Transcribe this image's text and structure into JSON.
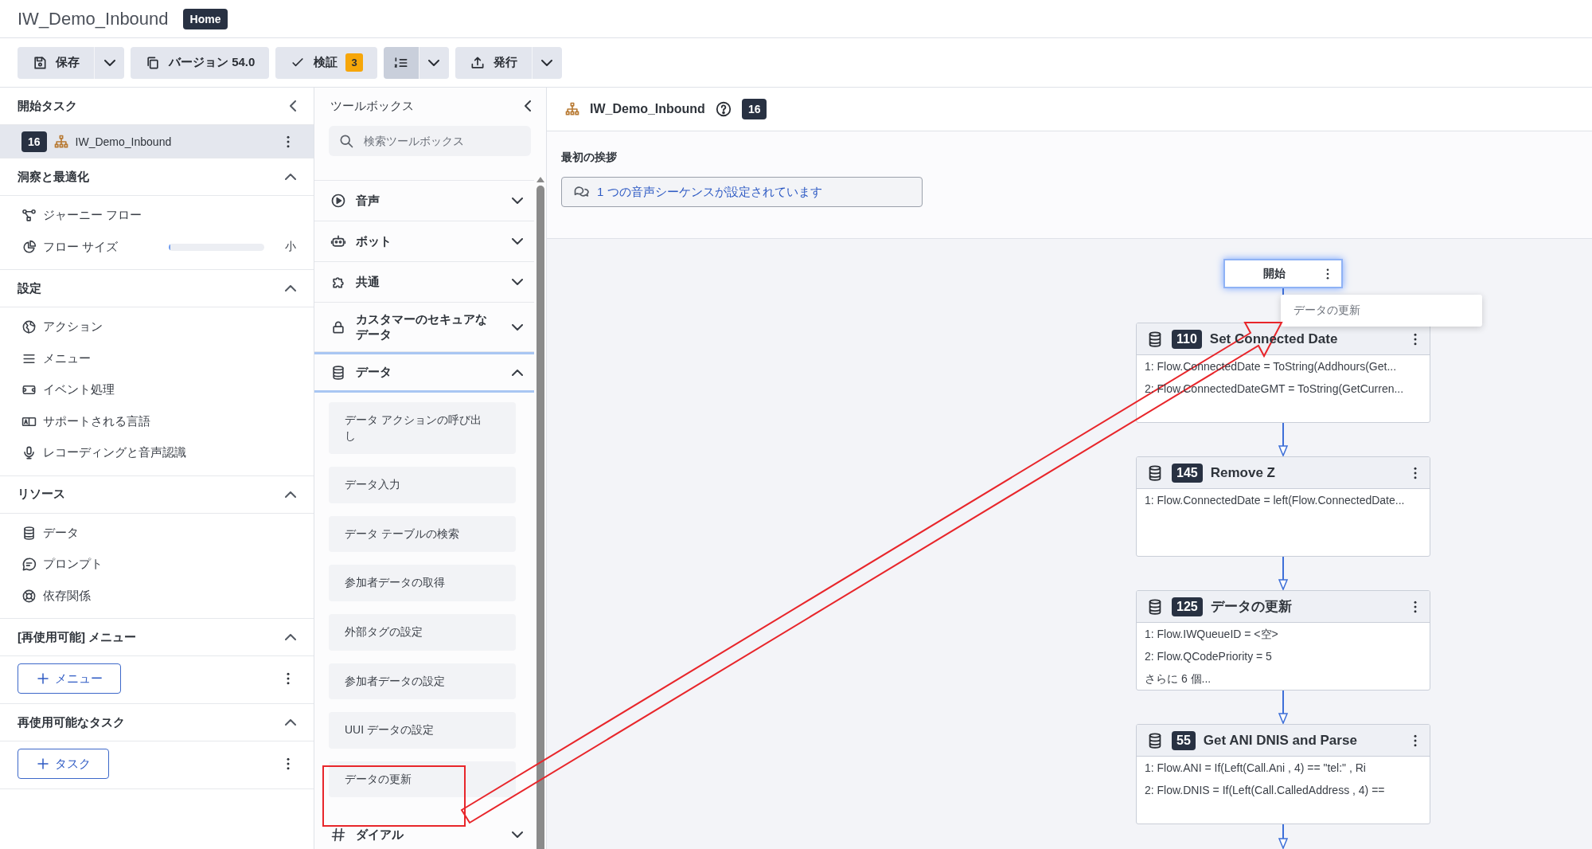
{
  "header": {
    "title": "IW_Demo_Inbound",
    "badge": "Home"
  },
  "toolbar": [
    {
      "label": "保存",
      "dropdown": true,
      "pressed": false
    },
    {
      "label": "バージョン 54.0",
      "dropdown": false,
      "pressed": false
    },
    {
      "label": "検証",
      "count": "3",
      "dropdown": false,
      "pressed": false
    },
    {
      "dropdown": true,
      "pressed": true
    },
    {
      "label": "発行",
      "dropdown": true,
      "pressed": false
    }
  ],
  "start_tasks": {
    "title": "開始タスク",
    "items": [
      {
        "badge": "16",
        "label": "IW_Demo_Inbound",
        "selected": true
      }
    ]
  },
  "sections": [
    {
      "title": "洞察と最適化",
      "expanded": true,
      "items": [
        {
          "kind": "link",
          "label": "ジャーニー フロー"
        },
        {
          "kind": "meter",
          "label": "フロー サイズ",
          "level": 0.02,
          "reading": "小"
        }
      ]
    },
    {
      "title": "設定",
      "expanded": true,
      "items": [
        {
          "kind": "link",
          "label": "アクション"
        },
        {
          "kind": "link",
          "label": "メニュー"
        },
        {
          "kind": "link",
          "label": "イベント処理"
        },
        {
          "kind": "link",
          "label": "サポートされる言語"
        },
        {
          "kind": "link",
          "label": "レコーディングと音声認識"
        }
      ]
    },
    {
      "title": "リソース",
      "expanded": true,
      "items": [
        {
          "kind": "link",
          "label": "データ"
        },
        {
          "kind": "link",
          "label": "プロンプト"
        },
        {
          "kind": "link",
          "label": "依存関係"
        }
      ]
    },
    {
      "title": "[再使用可能] メニュー",
      "expanded": true,
      "items": [
        {
          "kind": "add",
          "label": "メニュー"
        }
      ]
    },
    {
      "title": "再使用可能なタスク",
      "expanded": true,
      "items": [
        {
          "kind": "add",
          "label": "タスク"
        }
      ]
    }
  ],
  "toolbox": {
    "title": "ツールボックス",
    "search": {
      "placeholder": "検索ツールボックス"
    },
    "categories": [
      {
        "label": "音声",
        "expanded": false
      },
      {
        "label": "ボット",
        "expanded": false
      },
      {
        "label": "共通",
        "expanded": false
      },
      {
        "label": "カスタマーのセキュアなデータ",
        "expanded": false
      },
      {
        "label": "データ",
        "expanded": true,
        "items": [
          "データ アクションの呼び出し",
          "データ入力",
          "データ テーブルの検索",
          "参加者データの取得",
          "外部タグの設定",
          "参加者データの設定",
          "UUI データの設定",
          "データの更新"
        ]
      },
      {
        "label": "ダイアル",
        "expanded": false
      }
    ]
  },
  "flow_header": {
    "title": "IW_Demo_Inbound",
    "count": "16"
  },
  "greeting": {
    "label": "最初の挨拶",
    "value": "1 つの音声シーケンスが設定されています"
  },
  "canvas": {
    "start": {
      "label": "開始",
      "selected": true
    },
    "tooltip": "データの更新",
    "nodes": [
      {
        "number": "110",
        "title": "Set Connected Date",
        "lines": [
          "1: Flow.ConnectedDate = ToString(Addhours(Get...",
          "2: Flow.ConnectedDateGMT = ToString(GetCurren..."
        ]
      },
      {
        "number": "145",
        "title": "Remove Z",
        "lines": [
          "1: Flow.ConnectedDate = left(Flow.ConnectedDate..."
        ]
      },
      {
        "number": "125",
        "title": "データの更新",
        "lines": [
          "1: Flow.IWQueueID = <空>",
          "2: Flow.QCodePriority = 5",
          "さらに 6 個..."
        ]
      },
      {
        "number": "55",
        "title": "Get ANI DNIS and Parse",
        "lines": [
          "1: Flow.ANI = If(Left(Call.Ani , 4) == \"tel:\" , Ri",
          "2: Flow.DNIS = If(Left(Call.CalledAddress , 4) =="
        ]
      }
    ]
  }
}
